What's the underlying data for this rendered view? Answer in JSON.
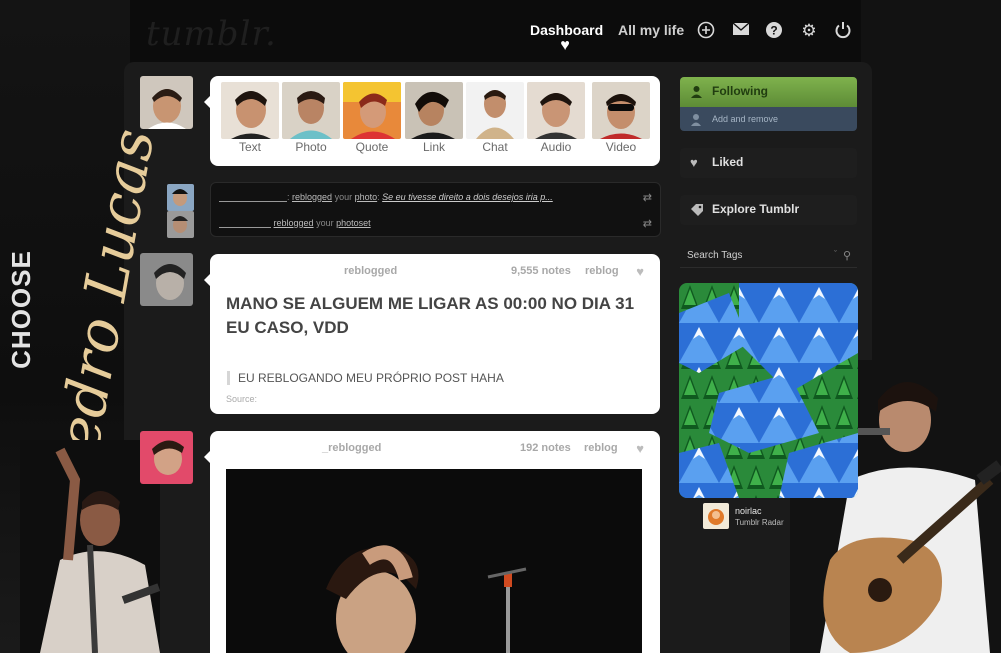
{
  "header": {
    "logo": "tumblr.",
    "nav": {
      "dashboard": "Dashboard",
      "blog": "All my life"
    },
    "icons": [
      "new-post-icon",
      "mail-icon",
      "help-icon",
      "settings-icon",
      "logout-icon"
    ]
  },
  "blog_art": {
    "choose": "CHOOSE",
    "name": "Pedro Lucas"
  },
  "post_box": {
    "items": [
      {
        "label": "Text"
      },
      {
        "label": "Photo"
      },
      {
        "label": "Quote"
      },
      {
        "label": "Link"
      },
      {
        "label": "Chat"
      },
      {
        "label": "Audio"
      },
      {
        "label": "Video"
      }
    ]
  },
  "notifications": [
    {
      "action": "reblogged",
      "your": "your",
      "type": "photo",
      "quote": "Se eu tivesse direito a dois desejos iria p..."
    },
    {
      "action": "reblogged",
      "your": "your",
      "type": "photoset"
    }
  ],
  "posts": [
    {
      "meta": "reblogged",
      "notes": "9,555 notes",
      "reblog": "reblog",
      "title": "MANO SE ALGUEM ME LIGAR AS 00:00 NO DIA 31 EU CASO, VDD",
      "quote": "EU REBLOGANDO MEU PRÓPRIO POST HAHA",
      "source": "Source:"
    },
    {
      "meta": "_reblogged",
      "notes": "192 notes",
      "reblog": "reblog"
    }
  ],
  "sidebar": {
    "following": "Following",
    "add_remove": "Add and remove",
    "liked": "Liked",
    "explore": "Explore Tumblr",
    "search_placeholder": "Search Tags",
    "radar_user": "noirlac",
    "radar_label": "Tumblr Radar"
  },
  "colors": {
    "background": "#0c0c0c",
    "column": "#1b1b1b",
    "following_green": "#6fa043",
    "following_blue": "#3a4a5e",
    "script_gold": "#e6cc9a"
  }
}
